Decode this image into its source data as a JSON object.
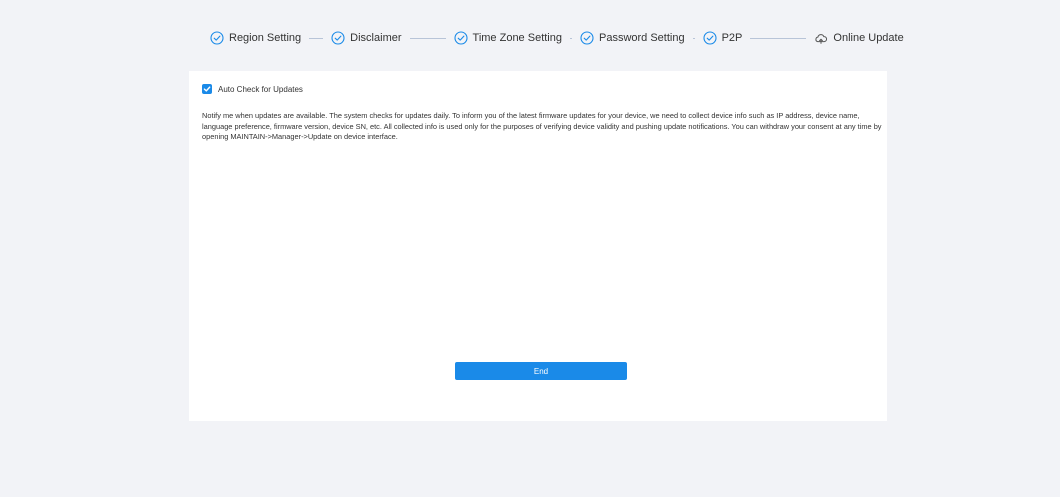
{
  "wizard": {
    "steps": [
      {
        "label": "Region Setting",
        "icon": "check-circle-icon",
        "status": "done"
      },
      {
        "label": "Disclaimer",
        "icon": "check-circle-icon",
        "status": "done"
      },
      {
        "label": "Time Zone Setting",
        "icon": "check-circle-icon",
        "status": "done"
      },
      {
        "label": "Password Setting",
        "icon": "check-circle-icon",
        "status": "done"
      },
      {
        "label": "P2P",
        "icon": "check-circle-icon",
        "status": "done"
      },
      {
        "label": "Online Update",
        "icon": "cloud-icon",
        "status": "current"
      }
    ]
  },
  "update": {
    "auto_check_label": "Auto Check for Updates",
    "auto_check_checked": true,
    "notice": "Notify me when updates are available. The system checks for updates daily. To inform you of the latest firmware updates for your device, we need to collect device info such as IP address, device name, language preference, firmware version, device SN, etc. All collected info is used only for the purposes of verifying device validity and pushing update notifications. You can withdraw your consent at any time by opening MAINTAIN->Manager->Update on device interface.",
    "end_button_label": "End"
  },
  "colors": {
    "accent": "#1a8ae8",
    "background": "#f2f3f7",
    "panel": "#ffffff",
    "connector": "#b8c4d8"
  }
}
